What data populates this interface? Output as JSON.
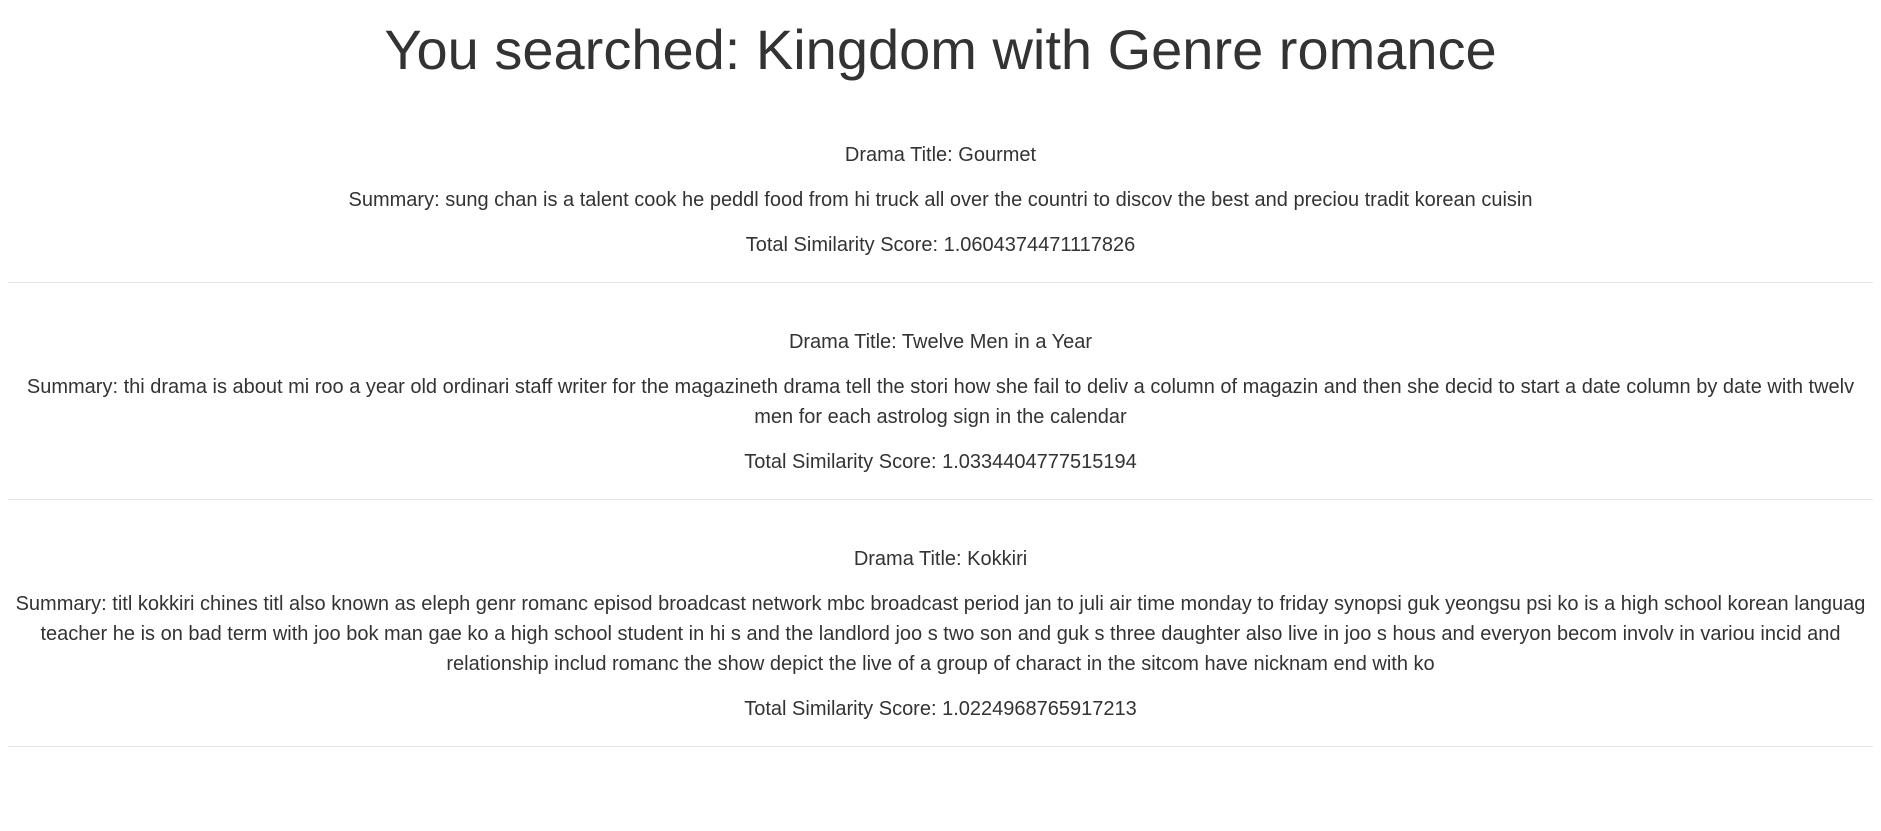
{
  "heading": "You searched: Kingdom with Genre romance",
  "results": [
    {
      "title": "Drama Title: Gourmet",
      "summary": "Summary: sung chan is a talent cook he peddl food from hi truck all over the countri to discov the best and preciou tradit korean cuisin",
      "score": "Total Similarity Score: 1.0604374471117826"
    },
    {
      "title": "Drama Title: Twelve Men in a Year",
      "summary": "Summary: thi drama is about mi roo a year old ordinari staff writer for the magazineth drama tell the stori how she fail to deliv a column of magazin and then she decid to start a date column by date with twelv men for each astrolog sign in the calendar",
      "score": "Total Similarity Score: 1.0334404777515194"
    },
    {
      "title": "Drama Title: Kokkiri",
      "summary": "Summary: titl kokkiri chines titl also known as eleph genr romanc episod broadcast network mbc broadcast period jan to juli air time monday to friday synopsi guk yeongsu psi ko is a high school korean languag teacher he is on bad term with joo bok man gae ko a high school student in hi s and the landlord joo s two son and guk s three daughter also live in joo s hous and everyon becom involv in variou incid and relationship includ romanc the show depict the live of a group of charact in the sitcom have nicknam end with ko",
      "score": "Total Similarity Score: 1.0224968765917213"
    }
  ]
}
